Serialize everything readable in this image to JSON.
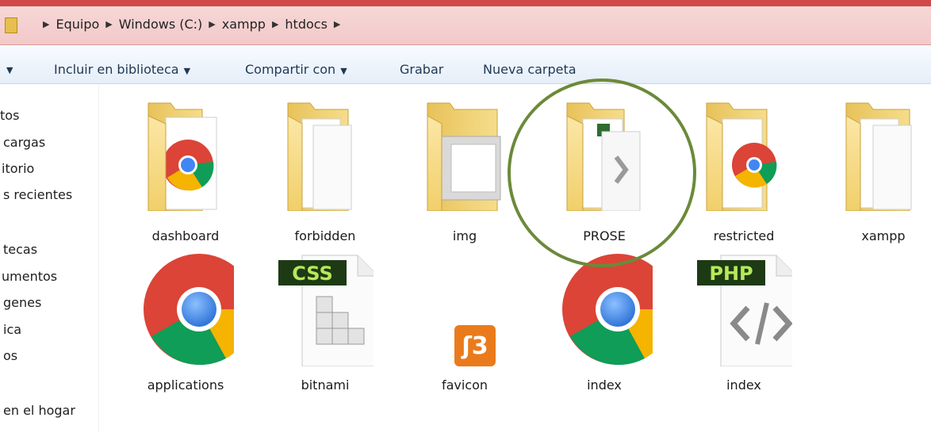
{
  "breadcrumb": [
    "Equipo",
    "Windows (C:)",
    "xampp",
    "htdocs"
  ],
  "toolbar": {
    "include_label": "Incluir en biblioteca",
    "share_label": "Compartir con",
    "burn_label": "Grabar",
    "new_folder_label": "Nueva carpeta"
  },
  "nav_items": [
    "tos",
    "cargas",
    "itorio",
    "s recientes",
    "tecas",
    "umentos",
    "genes",
    "ica",
    "os",
    "en el hogar"
  ],
  "files": [
    {
      "name": "dashboard",
      "icon": "folder-chrome-icon"
    },
    {
      "name": "forbidden",
      "icon": "folder-docs-icon"
    },
    {
      "name": "img",
      "icon": "folder-images-icon"
    },
    {
      "name": "PROSE",
      "icon": "folder-code-icon"
    },
    {
      "name": "restricted",
      "icon": "folder-chrome-icon"
    },
    {
      "name": "xampp",
      "icon": "folder-docs-icon"
    },
    {
      "name": "applications",
      "icon": "chrome-icon"
    },
    {
      "name": "bitnami",
      "icon": "css-file-icon"
    },
    {
      "name": "favicon",
      "icon": "xampp-icon"
    },
    {
      "name": "index",
      "icon": "chrome-icon"
    },
    {
      "name": "index",
      "icon": "php-file-icon"
    }
  ],
  "file_badges": {
    "css": "CSS",
    "php": "PHP"
  },
  "colors": {
    "highlight_circle": "#6b8a3a",
    "folder": "#f5d77a",
    "chrome_red": "#db4437",
    "chrome_green": "#0f9d58",
    "chrome_yellow": "#f4b400",
    "chrome_blue": "#4285f4"
  }
}
